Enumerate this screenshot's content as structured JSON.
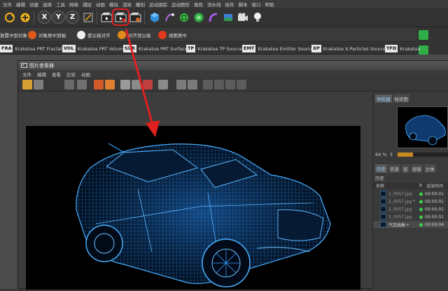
{
  "menubar": [
    "文件",
    "编辑",
    "创建",
    "选择",
    "工具",
    "网格",
    "捕捉",
    "动画",
    "模拟",
    "渲染",
    "雕刻",
    "运动跟踪",
    "运动图形",
    "角色",
    "流水线",
    "插件",
    "脚本",
    "窗口",
    "帮助"
  ],
  "toolbar": {
    "x_label": "X",
    "y_label": "Y",
    "z_label": "Z"
  },
  "plugin_row": [
    {
      "label": "放置中到对象",
      "color": "#e05a1a"
    },
    {
      "label": "对象居中到轴",
      "color": "#e05a1a"
    },
    {
      "label": "使父级对齐",
      "color": "#f0f0f0"
    },
    {
      "label": "对齐到父级",
      "color": "#e08a1a"
    },
    {
      "label": "视图居中",
      "color": "#e03a1a"
    }
  ],
  "krakatoa_row": [
    {
      "tag": "FRA",
      "label": "Krakatoa PRT Fractal"
    },
    {
      "tag": "VOL",
      "label": "Krakatoa PRT Volume"
    },
    {
      "tag": "SUR",
      "label": "Krakatoa PRT Surface"
    },
    {
      "tag": "TP",
      "label": "Krakatoa TP Source"
    },
    {
      "tag": "EMT",
      "label": "Krakatoa Emitter Source"
    },
    {
      "tag": "XP",
      "label": "Krakatoa X-Particles Source"
    },
    {
      "tag": "TFD",
      "label": "Krakatoa"
    }
  ],
  "picture_viewer": {
    "title": "图片查看器",
    "menu": [
      "文件",
      "编辑",
      "查看",
      "比较",
      "动画"
    ],
    "nav_tabs": [
      "导航器",
      "柱状图"
    ],
    "zoom": "64 %",
    "zoom_fraction": 0.3,
    "history_tabs": [
      "历史",
      "信息",
      "层",
      "滤镜",
      "立体"
    ],
    "history_label": "历史",
    "history_headers": {
      "name": "名称",
      "r": "R",
      "time": "渲染时间"
    },
    "history_rows": [
      {
        "name": "1_0057.jpg",
        "time": "00:00:01"
      },
      {
        "name": "2_0057.jpg *",
        "time": "00:00:01"
      },
      {
        "name": "2_0057.jpg",
        "time": "00:00:01"
      },
      {
        "name": "3_0057.jpg",
        "time": "00:00:01"
      },
      {
        "name": "汽车线框 *",
        "time": "00:00:04"
      }
    ]
  },
  "colors": {
    "wireframe": "#1e90ff",
    "highlight": "#e02020"
  }
}
